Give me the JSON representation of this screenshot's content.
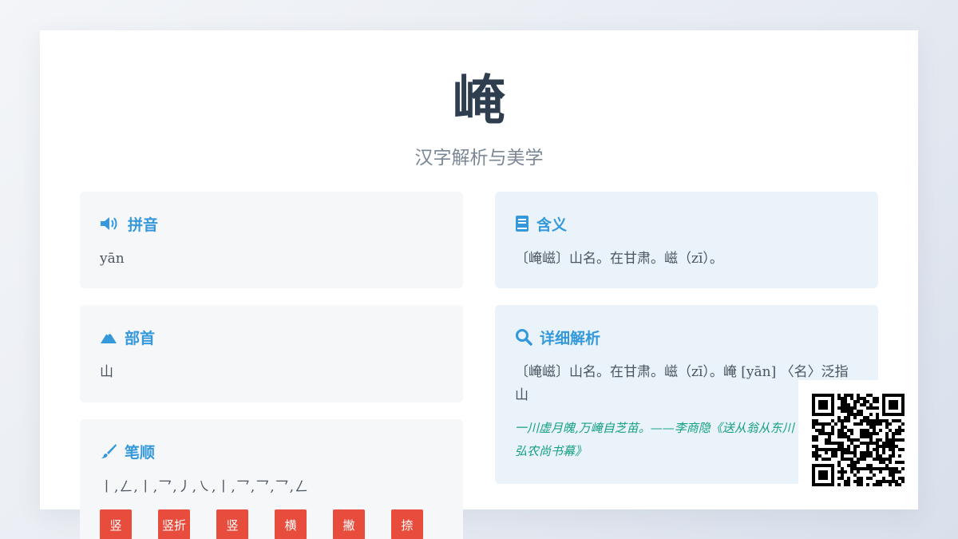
{
  "hero": {
    "character": "崦",
    "subtitle": "汉字解析与美学"
  },
  "pinyin": {
    "title": "拼音",
    "icon": "volume-icon",
    "value": "yān"
  },
  "meaning": {
    "title": "含义",
    "icon": "book-icon",
    "value": "〔崦嵫〕山名。在甘肃。嵫（zī）。"
  },
  "radical": {
    "title": "部首",
    "icon": "mountain-icon",
    "value": "山"
  },
  "detail": {
    "title": "详细解析",
    "icon": "search-icon",
    "text": "〔崦嵫〕山名。在甘肃。嵫（zī）。崦 [yān] 〈名〉泛指山",
    "example": "一川虚月魄,万崦自芝苗。——李商隐《送从翁从东川弘农尚书幕》"
  },
  "stroke_order": {
    "title": "笔顺",
    "icon": "brush-icon",
    "sequence": "丨,ㄥ,丨,乛,丿,㇏,丨,乛,乛,乛,ㄥ",
    "strokes": [
      "竖",
      "竖折",
      "竖",
      "横",
      "撇",
      "捺"
    ]
  },
  "colors": {
    "accent": "#3498db",
    "stroke_button": "#e74c3c",
    "example_text": "#16a085",
    "title_text": "#2f3e4f"
  }
}
